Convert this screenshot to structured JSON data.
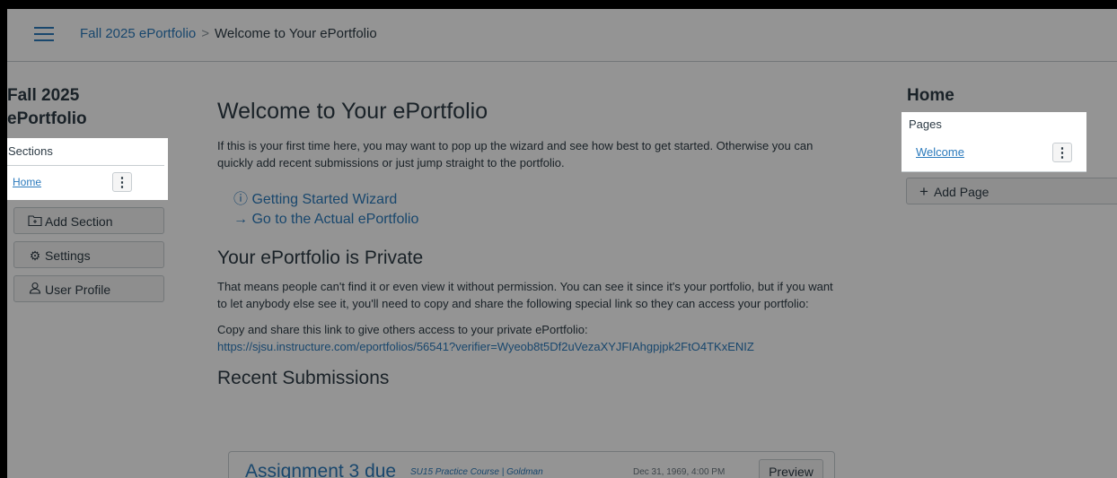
{
  "header": {
    "breadcrumb_root": "Fall 2025 ePortfolio",
    "breadcrumb_separator": ">",
    "breadcrumb_current": "Welcome to Your ePortfolio"
  },
  "sidebar": {
    "title_line1": "Fall 2025",
    "title_line2": "ePortfolio",
    "sections_heading": "Sections",
    "items": [
      {
        "label": "Home"
      }
    ],
    "add_section": "Add Section",
    "settings": "Settings",
    "user_profile": "User Profile"
  },
  "main": {
    "title": "Welcome to Your ePortfolio",
    "intro": "If this is your first time here, you may want to pop up the wizard and see how best to get started. Otherwise you can quickly add recent submissions or just jump straight to the portfolio.",
    "wizard_link": "Getting Started Wizard",
    "goto_link": "Go to the Actual ePortfolio",
    "private_title": "Your ePortfolio is Private",
    "private_text": "That means people can't find it or even view it without permission. You can see it since it's your portfolio, but if you want to let anybody else see it, you'll need to copy and share the following special link so they can access your portfolio:",
    "share_label": "Copy and share this link to give others access to your private ePortfolio:",
    "share_url": "https://sjsu.instructure.com/eportfolios/56541?verifier=Wyeob8t5Df2uVezaXYJFIAhgpjpk2FtO4TKxENIZ",
    "recent_title": "Recent Submissions",
    "submissions": [
      {
        "title": "Assignment 3 due",
        "course": "SU15 Practice Course | Goldman",
        "date": "Dec 31, 1969, 4:00 PM",
        "action": "Preview"
      }
    ]
  },
  "right_panel": {
    "title": "Home",
    "pages_heading": "Pages",
    "pages": [
      {
        "label": "Welcome"
      }
    ],
    "add_page": "Add Page"
  },
  "colors": {
    "accent": "#2b7abc",
    "text": "#2d3b45"
  }
}
